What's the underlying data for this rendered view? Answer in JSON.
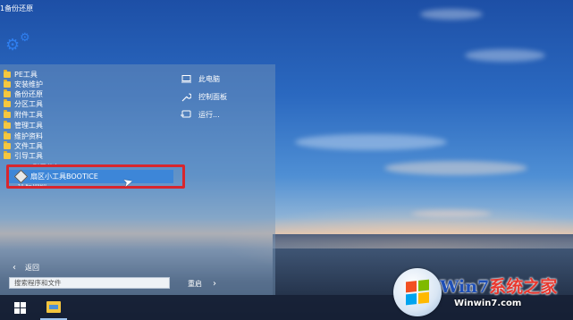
{
  "desktop": {
    "title_fragment": "1备份还原"
  },
  "start_menu": {
    "folders": [
      {
        "label": "PE工具"
      },
      {
        "label": "安装维护"
      },
      {
        "label": "备份还原"
      },
      {
        "label": "分区工具"
      },
      {
        "label": "附件工具"
      },
      {
        "label": "管理工具"
      },
      {
        "label": "维护资料"
      },
      {
        "label": "文件工具"
      },
      {
        "label": "引导工具"
      }
    ],
    "partial_top_label": "USB引导修复",
    "selected_item": {
      "label": "扇区小工具BOOTICE"
    },
    "partial_bottom_label": "远程协助",
    "right_pane": {
      "items": [
        {
          "label": "此电脑",
          "icon": "computer-icon"
        },
        {
          "label": "控制面板",
          "icon": "wrench-icon"
        },
        {
          "label": "运行...",
          "icon": "run-icon"
        }
      ]
    },
    "back_label": "返回",
    "search": {
      "placeholder": "搜索程序和文件"
    },
    "shutdown_label": "重启"
  },
  "taskbar": {
    "items": [
      {
        "name": "start-button",
        "icon": "windows-icon"
      },
      {
        "name": "file-explorer",
        "icon": "folder-icon"
      }
    ]
  },
  "watermark": {
    "brand_a": "Win7",
    "brand_b": "系统之家",
    "url": "Winwin7.com"
  },
  "colors": {
    "selection": "#3d86d8",
    "highlight_box": "#d8262d",
    "folder": "#f4c740"
  }
}
